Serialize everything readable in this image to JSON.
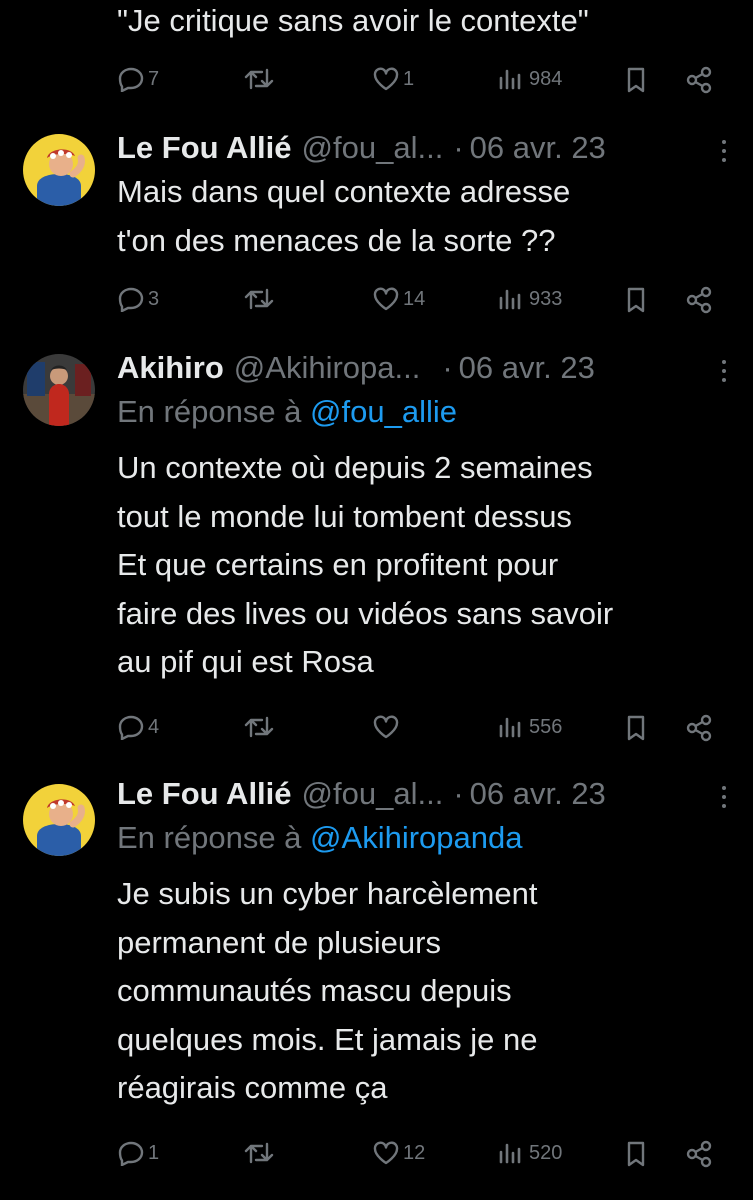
{
  "top": {
    "text": "\"Je critique sans avoir le contexte\"",
    "replies": "7",
    "retweets": "",
    "likes": "1",
    "views": "984"
  },
  "tweets": [
    {
      "name": "Le Fou Allié",
      "handle": "@fou_al...",
      "date": "06 avr. 23",
      "reply_prefix": "",
      "reply_to": "",
      "lines": [
        "Mais dans quel contexte adresse",
        "t'on des menaces de la sorte ??"
      ],
      "replies": "3",
      "retweets": "",
      "likes": "14",
      "views": "933"
    },
    {
      "name": "Akihiro",
      "handle": "@Akihiropa...",
      "date": "06 avr. 23",
      "reply_prefix": "En réponse à",
      "reply_to": "@fou_allie",
      "lines": [
        "Un contexte où depuis 2 semaines",
        "tout le monde lui tombent dessus",
        "Et que certains en profitent pour",
        "faire des lives ou vidéos sans savoir",
        "au pif qui est Rosa"
      ],
      "replies": "4",
      "retweets": "",
      "likes": "",
      "views": "556"
    },
    {
      "name": "Le Fou Allié",
      "handle": "@fou_al...",
      "date": "06 avr. 23",
      "reply_prefix": "En réponse à",
      "reply_to": "@Akihiropanda",
      "lines": [
        "Je subis un cyber harcèlement",
        "permanent de plusieurs",
        "communautés mascu depuis",
        "quelques mois. Et jamais je ne",
        "réagirais comme ça"
      ],
      "replies": "1",
      "retweets": "",
      "likes": "12",
      "views": "520"
    }
  ],
  "colors": {
    "background": "#000000",
    "text": "#e7e9ea",
    "muted": "#71767b",
    "link": "#1d9bf0"
  },
  "icons": [
    "reply-icon",
    "retweet-icon",
    "like-icon",
    "views-icon",
    "bookmark-icon",
    "share-icon",
    "more-icon"
  ]
}
